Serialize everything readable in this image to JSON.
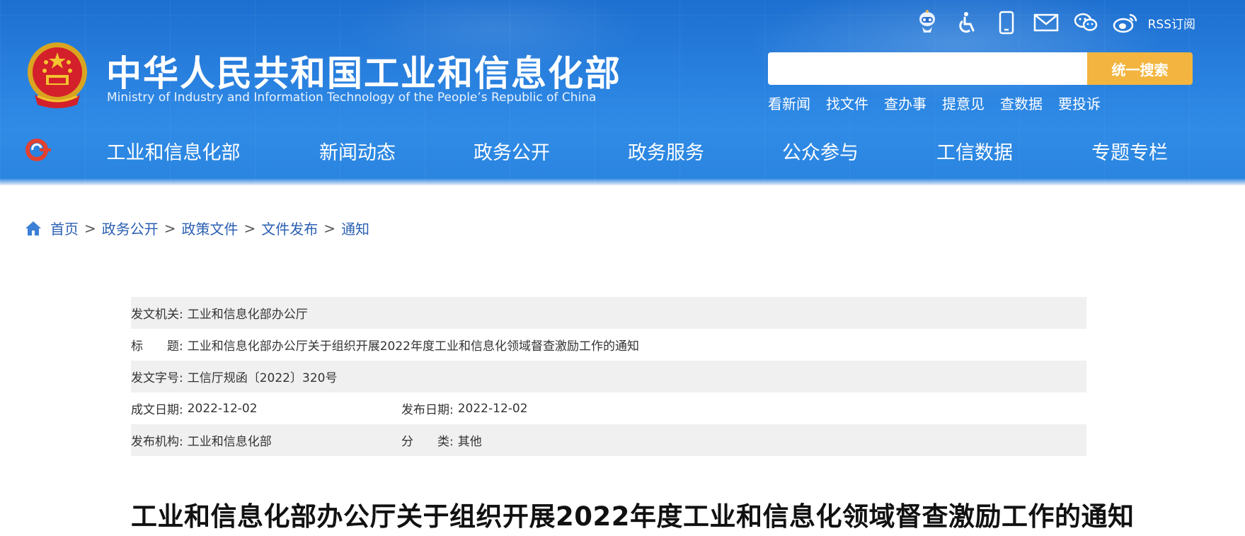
{
  "header": {
    "title": "中华人民共和国工业和信息化部",
    "subtitle": "Ministry of Industry and Information Technology of the People’s Republic of China",
    "top_icons": [
      "robot-assistant-icon",
      "accessibility-icon",
      "mobile-phone-icon",
      "mail-icon",
      "wechat-icon",
      "weibo-icon"
    ],
    "rss_label": "RSS订阅",
    "search_value": "",
    "search_button": "统一搜索",
    "quick_links": [
      "看新闻",
      "找文件",
      "查办事",
      "提意见",
      "查数据",
      "要投诉"
    ]
  },
  "nav": {
    "items": [
      "工业和信息化部",
      "新闻动态",
      "政务公开",
      "政务服务",
      "公众参与",
      "工信数据",
      "专题专栏"
    ]
  },
  "breadcrumb": {
    "items": [
      "首页",
      "政务公开",
      "政策文件",
      "文件发布",
      "通知"
    ],
    "separator": ">"
  },
  "document_meta": {
    "issuer_label": "发文机关:",
    "issuer": "工业和信息化部办公厅",
    "title_label": "标　　题:",
    "title": "工业和信息化部办公厅关于组织开展2022年度工业和信息化领域督查激励工作的通知",
    "doc_number_label": "发文字号:",
    "doc_number": "工信厅规函〔2022〕320号",
    "written_date_label": "成文日期:",
    "written_date": "2022-12-02",
    "publish_date_label": "发布日期:",
    "publish_date": "2022-12-02",
    "org_label": "发布机构:",
    "org": "工业和信息化部",
    "category_label": "分　　类:",
    "category": "其他"
  },
  "document_title": "工业和信息化部办公厅关于组织开展2022年度工业和信息化领域督查激励工作的通知",
  "colors": {
    "header_blue": "#2a82e0",
    "search_button": "#f3b53f",
    "link_blue": "#2a5fb2",
    "row_shade": "#f0f0f0"
  }
}
